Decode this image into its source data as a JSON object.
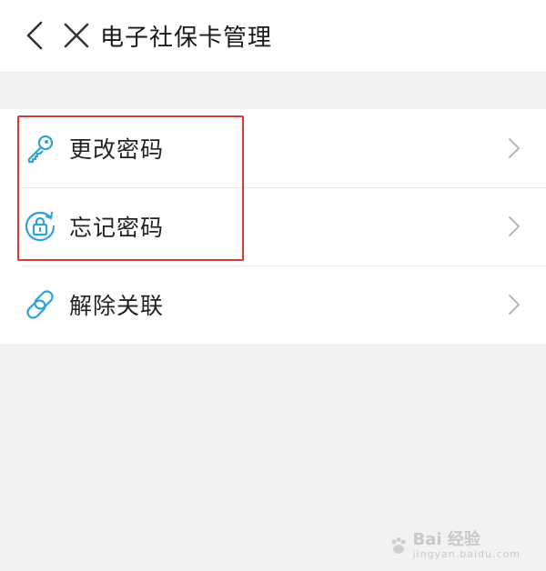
{
  "header": {
    "title": "电子社保卡管理",
    "back_icon": "chevron-left-icon",
    "close_icon": "close-icon"
  },
  "menu": {
    "items": [
      {
        "label": "更改密码",
        "icon": "key-icon"
      },
      {
        "label": "忘记密码",
        "icon": "lock-refresh-icon"
      },
      {
        "label": "解除关联",
        "icon": "link-icon"
      }
    ]
  },
  "colors": {
    "accent": "#2fa3d8",
    "highlight": "#d93a35",
    "background": "#f2f2f2"
  },
  "watermark": {
    "text": "Bai  经验",
    "sub": "jingyan.baidu.com"
  }
}
